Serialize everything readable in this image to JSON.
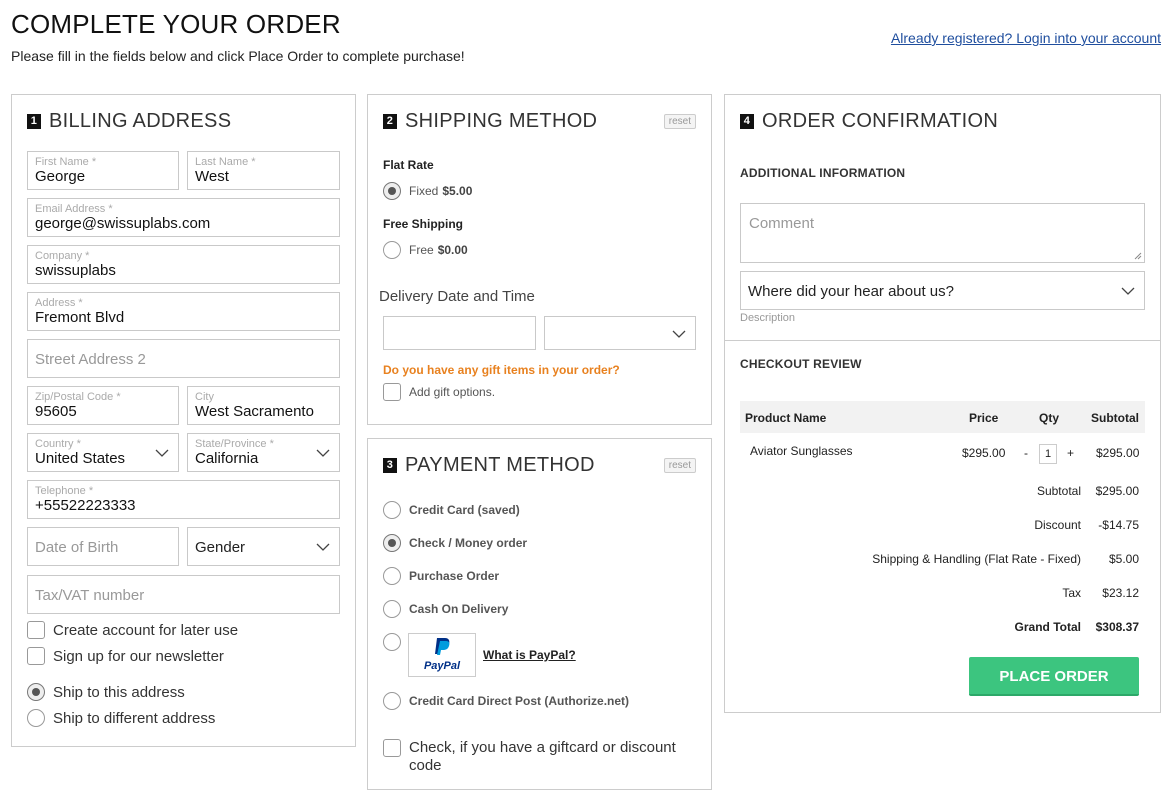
{
  "page": {
    "title": "COMPLETE YOUR ORDER",
    "subtitle": "Please fill in the fields below and click Place Order to complete purchase!",
    "login_link": "Already registered? Login into your account"
  },
  "billing": {
    "number": "1",
    "title": "BILLING ADDRESS",
    "first_name": {
      "label": "First Name *",
      "value": "George"
    },
    "last_name": {
      "label": "Last Name *",
      "value": "West"
    },
    "email": {
      "label": "Email Address *",
      "value": "george@swissuplabs.com"
    },
    "company": {
      "label": "Company *",
      "value": "swissuplabs"
    },
    "address": {
      "label": "Address *",
      "value": "Fremont Blvd"
    },
    "street2": {
      "placeholder": "Street Address 2"
    },
    "zip": {
      "label": "Zip/Postal Code *",
      "value": "95605"
    },
    "city": {
      "label": "City",
      "value": "West Sacramento"
    },
    "country": {
      "label": "Country *",
      "value": "United States"
    },
    "state": {
      "label": "State/Province *",
      "value": "California"
    },
    "telephone": {
      "label": "Telephone *",
      "value": "+55522223333"
    },
    "dob": {
      "placeholder": "Date of Birth"
    },
    "gender": {
      "value": "Gender"
    },
    "taxvat": {
      "placeholder": "Tax/VAT number"
    },
    "create_account": "Create account for later use",
    "newsletter": "Sign up for our newsletter",
    "ship_same": "Ship to this address",
    "ship_different": "Ship to different address"
  },
  "shipping": {
    "number": "2",
    "title": "SHIPPING METHOD",
    "reset": "reset",
    "flat_rate": {
      "carrier": "Flat Rate",
      "method": "Fixed",
      "price": "$5.00",
      "selected": true
    },
    "free": {
      "carrier": "Free Shipping",
      "method": "Free",
      "price": "$0.00",
      "selected": false
    },
    "delivery_label": "Delivery Date and Time",
    "gift_question": "Do you have any gift items in your order?",
    "gift_option": "Add gift options."
  },
  "payment": {
    "number": "3",
    "title": "PAYMENT METHOD",
    "reset": "reset",
    "methods": [
      {
        "label": "Credit Card (saved)",
        "selected": false
      },
      {
        "label": "Check / Money order",
        "selected": true
      },
      {
        "label": "Purchase Order",
        "selected": false
      },
      {
        "label": "Cash On Delivery",
        "selected": false
      }
    ],
    "paypal_logo": "PayPal",
    "paypal_link": "What is PayPal?",
    "authorize": "Credit Card Direct Post (Authorize.net)",
    "giftcard": "Check, if you have a giftcard or discount code"
  },
  "confirmation": {
    "number": "4",
    "title": "ORDER CONFIRMATION",
    "additional_info": "ADDITIONAL INFORMATION",
    "comment_placeholder": "Comment",
    "hear_about": "Where did your hear about us?",
    "description": "Description",
    "checkout_review": "CHECKOUT REVIEW",
    "columns": {
      "product": "Product Name",
      "price": "Price",
      "qty": "Qty",
      "subtotal": "Subtotal"
    },
    "items": [
      {
        "name": "Aviator Sunglasses",
        "price": "$295.00",
        "qty": "1",
        "subtotal": "$295.00"
      }
    ],
    "totals": {
      "subtotal_label": "Subtotal",
      "subtotal": "$295.00",
      "discount_label": "Discount",
      "discount": "-$14.75",
      "shipping_label": "Shipping & Handling (Flat Rate - Fixed)",
      "shipping": "$5.00",
      "tax_label": "Tax",
      "tax": "$23.12",
      "grand_label": "Grand Total",
      "grand": "$308.37"
    },
    "place_order": "PLACE ORDER"
  }
}
